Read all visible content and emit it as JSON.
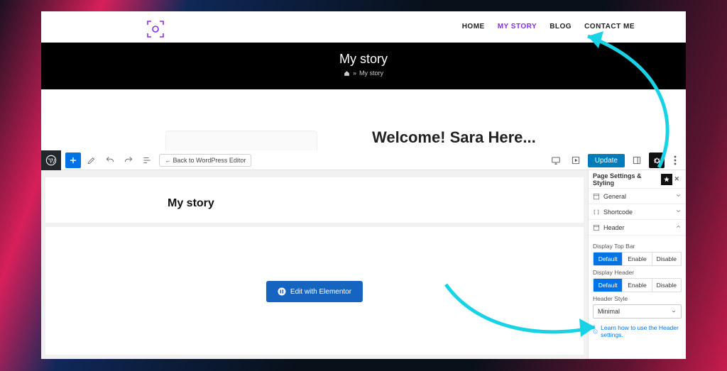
{
  "nav": {
    "home": "HOME",
    "mystory": "MY STORY",
    "blog": "BLOG",
    "contact": "CONTACT ME"
  },
  "hero": {
    "title": "My story",
    "breadcrumb_current": "My story",
    "welcome": "Welcome! Sara Here..."
  },
  "toolbar": {
    "back": "← Back to WordPress Editor",
    "update": "Update"
  },
  "canvas": {
    "title": "My story",
    "elementor": "Edit with Elementor"
  },
  "sidebar": {
    "title": "Page Settings & Styling",
    "general": "General",
    "shortcode": "Shortcode",
    "header": "Header",
    "display_top_bar": "Display Top Bar",
    "display_header": "Display Header",
    "header_style": "Header Style",
    "opts": {
      "default": "Default",
      "enable": "Enable",
      "disable": "Disable"
    },
    "style_value": "Minimal",
    "help": "Learn how to use the Header settings."
  }
}
